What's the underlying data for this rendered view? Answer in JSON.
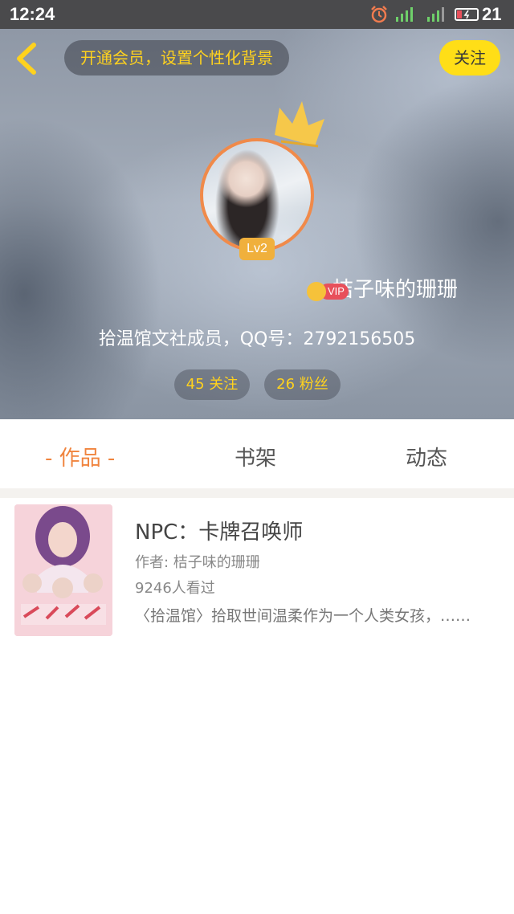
{
  "status_bar": {
    "time": "12:24",
    "battery_level": "21",
    "icons": [
      "alarm-icon",
      "signal-1-icon",
      "signal-2-4g-icon",
      "battery-charging-icon"
    ]
  },
  "header": {
    "vip_banner_text": "开通会员，设置个性化背景",
    "follow_label": "关注",
    "level": "Lv2",
    "nickname": "桔子味的珊珊",
    "vip_label": "VIP",
    "bio": "拾温馆文社成员，QQ号：2792156505",
    "following_label": "45 关注",
    "fans_label": "26 粉丝"
  },
  "tabs": [
    "- 作品 -",
    "书架",
    "动态"
  ],
  "works": [
    {
      "title": "NPC：卡牌召唤师",
      "author": "作者: 桔子味的珊珊",
      "views": "9246人看过",
      "description": "〈拾温馆〉拾取世间温柔作为一个人类女孩，……"
    }
  ],
  "colors": {
    "accent_orange": "#f0843e",
    "follow_button": "#ffde17",
    "vip_text": "#ffd21e",
    "vip_badge": "#e8505b"
  }
}
